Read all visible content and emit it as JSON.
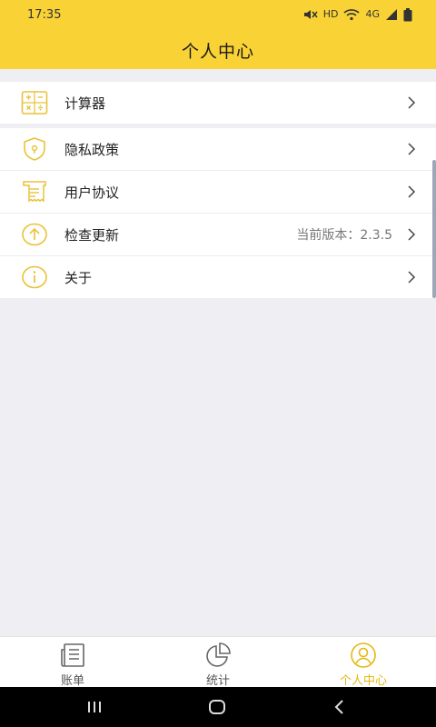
{
  "status_bar": {
    "time": "17:35",
    "network_label": "HD",
    "signal_label": "4G"
  },
  "header": {
    "title": "个人中心"
  },
  "menu_group_1": [
    {
      "label": "计算器",
      "icon": "calculator-icon"
    }
  ],
  "menu_group_2": [
    {
      "label": "隐私政策",
      "icon": "shield-icon"
    },
    {
      "label": "用户协议",
      "icon": "document-icon"
    },
    {
      "label": "检查更新",
      "icon": "upload-circle-icon",
      "value": "当前版本：2.3.5"
    },
    {
      "label": "关于",
      "icon": "info-icon"
    }
  ],
  "tabbar": {
    "tabs": [
      {
        "label": "账单",
        "icon": "ledger-icon",
        "active": false
      },
      {
        "label": "统计",
        "icon": "pie-chart-icon",
        "active": false
      },
      {
        "label": "个人中心",
        "icon": "user-icon",
        "active": true
      }
    ]
  },
  "colors": {
    "accent": "#f9d236",
    "icon_yellow": "#e9c23a",
    "active_tab": "#e5b711",
    "background": "#efeff3"
  }
}
